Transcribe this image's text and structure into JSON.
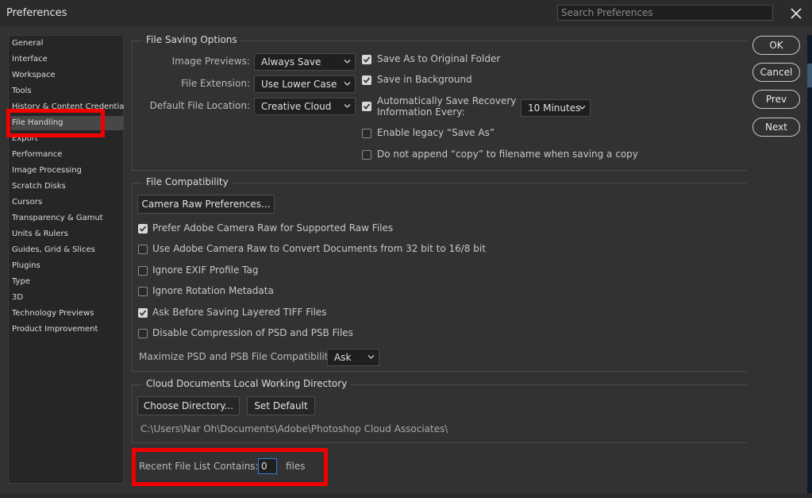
{
  "window": {
    "title": "Preferences",
    "search_placeholder": "Search Preferences"
  },
  "sidebar": {
    "items": [
      {
        "label": "General"
      },
      {
        "label": "Interface"
      },
      {
        "label": "Workspace"
      },
      {
        "label": "Tools"
      },
      {
        "label": "History & Content Credentials"
      },
      {
        "label": "File Handling",
        "selected": true
      },
      {
        "label": "Export"
      },
      {
        "label": "Performance"
      },
      {
        "label": "Image Processing"
      },
      {
        "label": "Scratch Disks"
      },
      {
        "label": "Cursors"
      },
      {
        "label": "Transparency & Gamut"
      },
      {
        "label": "Units & Rulers"
      },
      {
        "label": "Guides, Grid & Slices"
      },
      {
        "label": "Plugins"
      },
      {
        "label": "Type"
      },
      {
        "label": "3D"
      },
      {
        "label": "Technology Previews"
      },
      {
        "label": "Product Improvement"
      }
    ]
  },
  "file_saving": {
    "title": "File Saving Options",
    "image_previews_label": "Image Previews:",
    "image_previews_value": "Always Save",
    "file_extension_label": "File Extension:",
    "file_extension_value": "Use Lower Case",
    "default_location_label": "Default File Location:",
    "default_location_value": "Creative Cloud",
    "save_as_original": {
      "label": "Save As to Original Folder",
      "checked": true
    },
    "save_background": {
      "label": "Save in Background",
      "checked": true
    },
    "auto_recovery": {
      "label_line1": "Automatically Save Recovery",
      "label_line2": "Information Every:",
      "checked": true
    },
    "auto_recovery_interval": "10 Minutes",
    "legacy_save_as": {
      "label": "Enable legacy “Save As”",
      "checked": false
    },
    "no_copy": {
      "label": "Do not append “copy” to filename when saving a copy",
      "checked": false
    }
  },
  "compat": {
    "title": "File Compatibility",
    "camera_raw_button": "Camera Raw Preferences...",
    "prefer_acr": {
      "label": "Prefer Adobe Camera Raw for Supported Raw Files",
      "checked": true
    },
    "use_acr_32": {
      "label": "Use Adobe Camera Raw to Convert Documents from 32 bit to 16/8 bit",
      "checked": false
    },
    "ignore_exif": {
      "label": "Ignore EXIF Profile Tag",
      "checked": false
    },
    "ignore_rotation": {
      "label": "Ignore Rotation Metadata",
      "checked": false
    },
    "ask_tiff": {
      "label": "Ask Before Saving Layered TIFF Files",
      "checked": true
    },
    "disable_compression": {
      "label": "Disable Compression of PSD and PSB Files",
      "checked": false
    },
    "maximize_label": "Maximize PSD and PSB File Compatibility:",
    "maximize_value": "Ask"
  },
  "cloud": {
    "title": "Cloud Documents Local Working Directory",
    "choose_button": "Choose Directory...",
    "default_button": "Set Default",
    "path": "C:\\Users\\Nar Oh\\Documents\\Adobe\\Photoshop Cloud Associates\\"
  },
  "recent": {
    "label": "Recent File List Contains:",
    "value": "0",
    "suffix": "files"
  },
  "buttons": {
    "ok": "OK",
    "cancel": "Cancel",
    "prev": "Prev",
    "next": "Next"
  },
  "colors": {
    "highlight_box": "#f00000",
    "focus_border": "#2d7fe2",
    "background": "#323232"
  }
}
